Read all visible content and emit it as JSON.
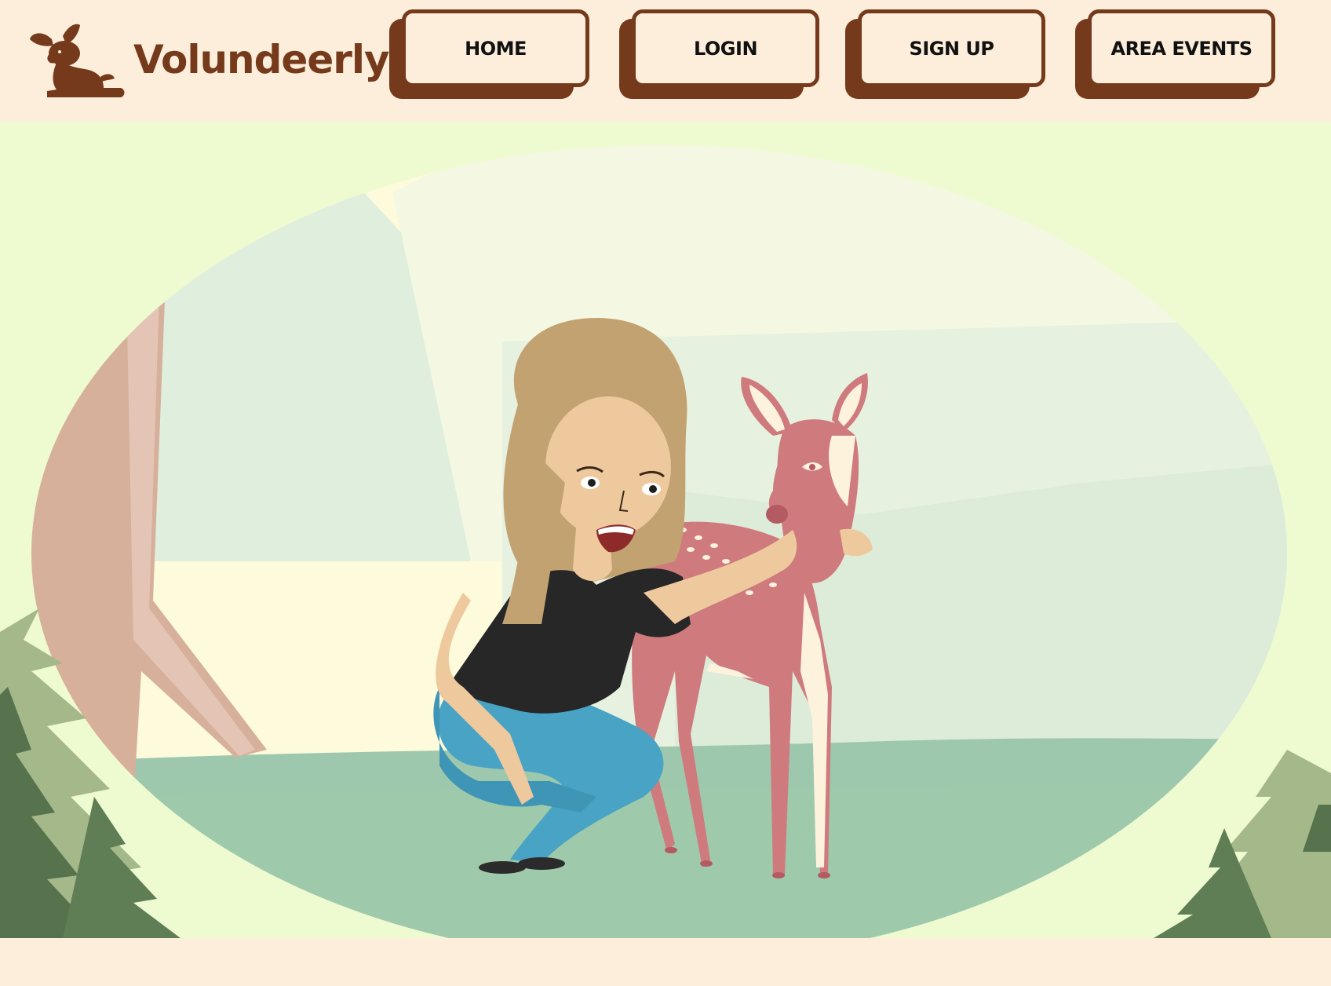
{
  "brand": {
    "name": "Volundeerly",
    "logo_icon": "fawn-icon"
  },
  "nav": {
    "items": [
      {
        "label": "HOME"
      },
      {
        "label": "LOGIN"
      },
      {
        "label": "SIGN UP"
      },
      {
        "label": "AREA EVENTS"
      }
    ]
  },
  "hero": {
    "illustration": "woman-petting-deer-illustration"
  },
  "colors": {
    "brand_brown": "#753a1b",
    "background_cream": "#fdeedb",
    "hero_green": "#eefad0"
  }
}
